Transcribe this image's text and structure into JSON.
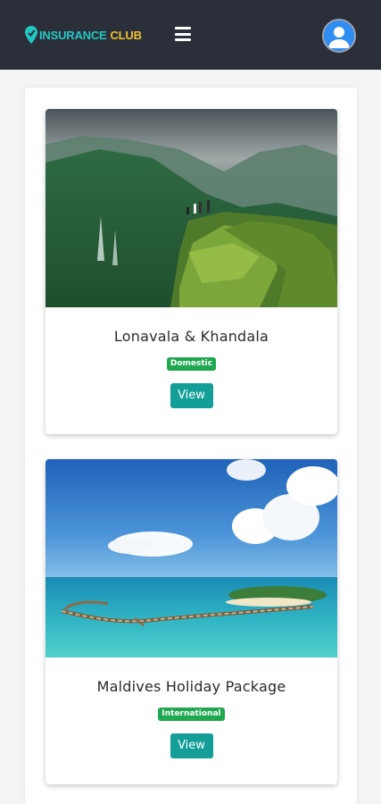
{
  "header": {
    "logo_part1": "INSURANCE",
    "logo_part2": "CLUB",
    "menu_icon": "hamburger-icon",
    "profile_icon": "user-avatar-icon"
  },
  "colors": {
    "header_bg": "#2b2f3a",
    "logo_primary": "#22c7c0",
    "logo_accent": "#f2c12e",
    "badge_green": "#1fa84f",
    "button_teal": "#139e98"
  },
  "cards": [
    {
      "title": "Lonavala & Khandala",
      "badge": "Domestic",
      "button_label": "View",
      "image_icon": "mountain-landscape-image"
    },
    {
      "title": "Maldives Holiday Package",
      "badge": "International",
      "button_label": "View",
      "image_icon": "beach-resort-image"
    }
  ]
}
